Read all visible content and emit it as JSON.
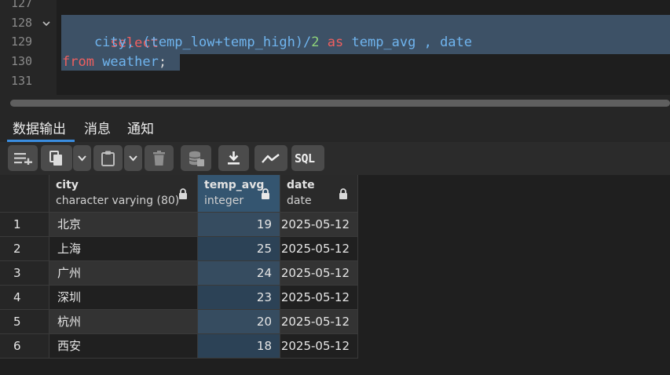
{
  "editor": {
    "line_numbers": [
      "127",
      "128",
      "129",
      "130",
      "131"
    ],
    "code": {
      "kw_select": "select",
      "l129_city": "    city, (temp_low+temp_high)/",
      "l129_num": "2",
      "l129_as": " as ",
      "l129_rest": "temp_avg , date",
      "kw_from": "from",
      "l130_table": " weather",
      "l130_semi": ";"
    }
  },
  "panel": {
    "tabs": [
      "数据输出",
      "消息",
      "通知"
    ],
    "active_tab": 0,
    "toolbar": {
      "icons": [
        "add-row-icon",
        "copy-icon",
        "dropdown-icon",
        "paste-icon",
        "dropdown-icon",
        "delete-icon",
        "save-data-icon",
        "download-icon",
        "graph-icon",
        "sql-icon"
      ],
      "sql_label": "SQL"
    }
  },
  "grid": {
    "columns": [
      {
        "name": "city",
        "type": "character varying (80)"
      },
      {
        "name": "temp_avg",
        "type": "integer"
      },
      {
        "name": "date",
        "type": "date"
      }
    ],
    "rows": [
      {
        "idx": "1",
        "city": "北京",
        "temp_avg": "19",
        "date": "2025-05-12"
      },
      {
        "idx": "2",
        "city": "上海",
        "temp_avg": "25",
        "date": "2025-05-12"
      },
      {
        "idx": "3",
        "city": "广州",
        "temp_avg": "24",
        "date": "2025-05-12"
      },
      {
        "idx": "4",
        "city": "深圳",
        "temp_avg": "23",
        "date": "2025-05-12"
      },
      {
        "idx": "5",
        "city": "杭州",
        "temp_avg": "20",
        "date": "2025-05-12"
      },
      {
        "idx": "6",
        "city": "西安",
        "temp_avg": "18",
        "date": "2025-05-12"
      }
    ]
  },
  "colors": {
    "selection": "#3d5166",
    "keyword": "#ef5f5f",
    "identifier": "#6fb4ee",
    "number": "#8fd37a",
    "active_column": "#345570",
    "tab_accent": "#3a8de0"
  }
}
